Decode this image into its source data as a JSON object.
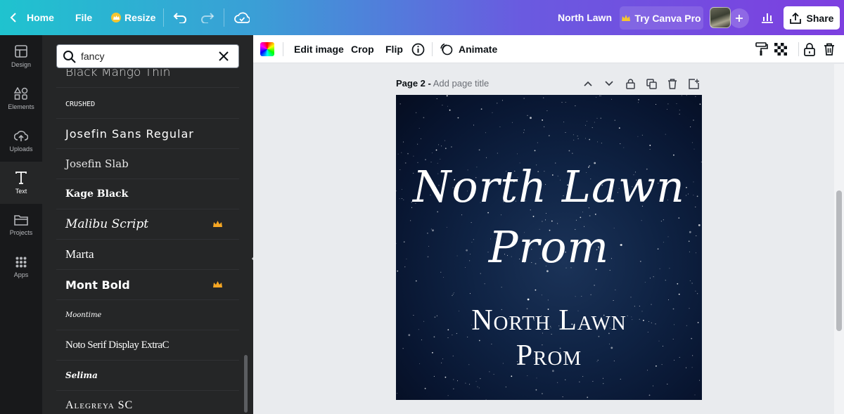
{
  "topbar": {
    "home_label": "Home",
    "file_label": "File",
    "resize_label": "Resize",
    "design_title": "North Lawn",
    "try_pro_label": "Try Canva Pro",
    "share_label": "Share"
  },
  "rail": {
    "items": [
      {
        "label": "Design",
        "icon": "design-icon"
      },
      {
        "label": "Elements",
        "icon": "elements-icon"
      },
      {
        "label": "Uploads",
        "icon": "upload-icon"
      },
      {
        "label": "Text",
        "icon": "text-icon"
      },
      {
        "label": "Projects",
        "icon": "folder-icon"
      },
      {
        "label": "Apps",
        "icon": "apps-icon"
      }
    ],
    "active": "Text"
  },
  "panel": {
    "search_value": "fancy",
    "fonts": [
      {
        "name": "Black Mango Thin",
        "pro": false
      },
      {
        "name": "Crushed",
        "pro": false
      },
      {
        "name": "Josefin Sans Regular",
        "pro": false
      },
      {
        "name": "Josefin Slab",
        "pro": false
      },
      {
        "name": "Kage Black",
        "pro": false
      },
      {
        "name": "Malibu Script",
        "pro": true
      },
      {
        "name": "Marta",
        "pro": false
      },
      {
        "name": "Mont Bold",
        "pro": true
      },
      {
        "name": "Moontime",
        "pro": false
      },
      {
        "name": "Noto Serif Display ExtraC",
        "pro": false
      },
      {
        "name": "Selima",
        "pro": false
      },
      {
        "name": "Alegreya SC",
        "pro": false
      }
    ]
  },
  "context_toolbar": {
    "edit_image_label": "Edit image",
    "crop_label": "Crop",
    "flip_label": "Flip",
    "animate_label": "Animate"
  },
  "page": {
    "number_label": "Page 2 -",
    "title_placeholder": "Add page title"
  },
  "artboard": {
    "title_line1": "North Lawn",
    "title_line2": "Prom",
    "sub_line1": "North Lawn",
    "sub_line2": "Prom"
  },
  "colors": {
    "accent": "#7d3fe0",
    "teal": "#1fc3cf",
    "panel_bg": "#252627",
    "rail_bg": "#18191b",
    "crown": "#f5a623"
  }
}
